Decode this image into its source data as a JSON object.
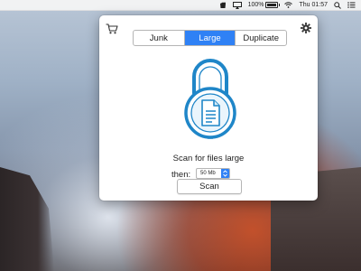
{
  "menubar": {
    "app_icon": "cleaner-icon",
    "airplay_icon": "airplay-icon",
    "wifi_icon": "wifi-icon",
    "battery_icon": "battery-icon",
    "battery_percent": "100%",
    "time": "Thu 01:57",
    "search_icon": "search-icon",
    "list_icon": "notification-list-icon"
  },
  "popover": {
    "cart_icon": "cart-icon",
    "gear_icon": "gear-icon",
    "tabs": [
      {
        "label": "Junk"
      },
      {
        "label": "Large",
        "active": true
      },
      {
        "label": "Duplicate"
      }
    ],
    "illustration_icon": "lock-document-icon",
    "scan_text": "Scan for files large",
    "then_label": "then:",
    "size_select_value": "50 Mb",
    "scan_button_label": "Scan",
    "accent_color": "#2f81f5"
  }
}
